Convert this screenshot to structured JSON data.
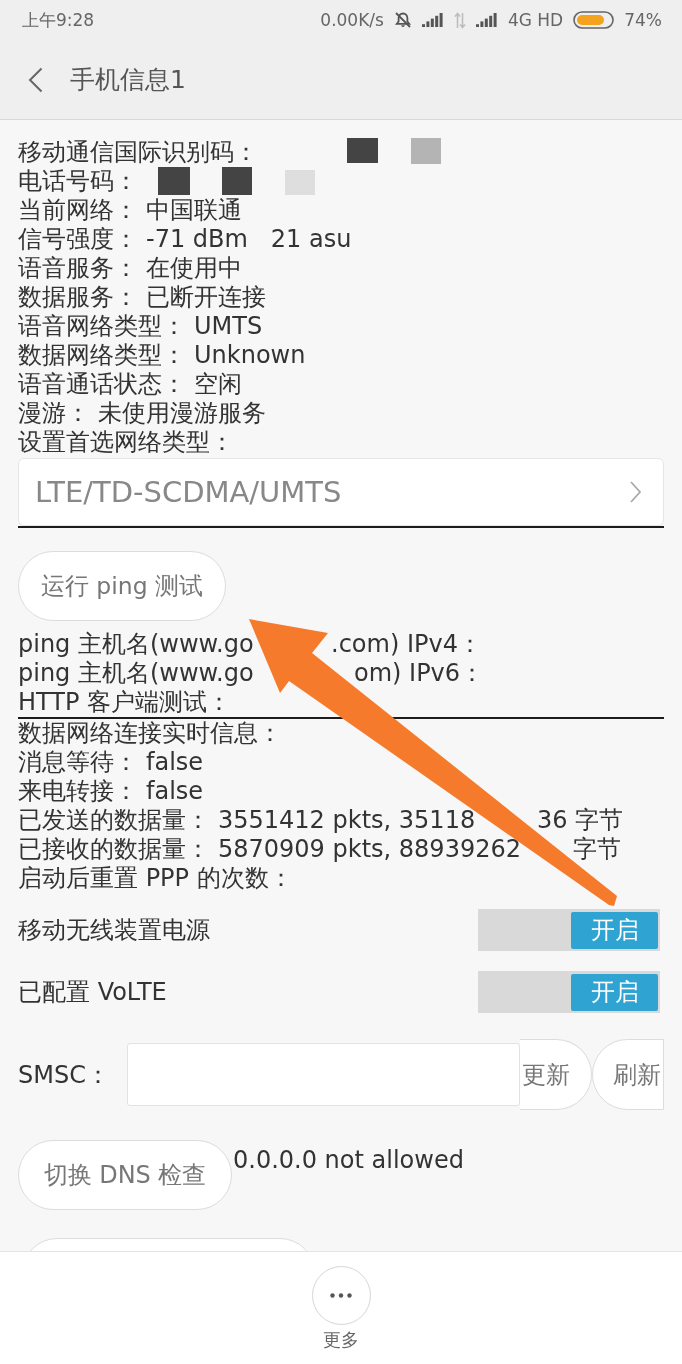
{
  "status_bar": {
    "time": "上午9:28",
    "speed": "0.00K/s",
    "network": "4G HD",
    "battery": "74%"
  },
  "header": {
    "title": "手机信息1"
  },
  "phone_info": [
    {
      "label": "移动通信国际识别码：",
      "redacted": true
    },
    {
      "label": "电话号码：",
      "redacted": true
    },
    {
      "label": "当前网络：",
      "value": "中国联通"
    },
    {
      "label": "信号强度：",
      "value": "-71 dBm   21 asu"
    },
    {
      "label": "语音服务：",
      "value": "在使用中"
    },
    {
      "label": "数据服务：",
      "value": "已断开连接"
    },
    {
      "label": "语音网络类型：",
      "value": "UMTS"
    },
    {
      "label": "数据网络类型：",
      "value": "Unknown"
    },
    {
      "label": "语音通话状态：",
      "value": "空闲"
    },
    {
      "label": "漫游：",
      "value": "未使用漫游服务"
    },
    {
      "label": "设置首选网络类型："
    }
  ],
  "preferred_network": {
    "value": "LTE/TD-SCDMA/UMTS"
  },
  "ping_button": {
    "label": "运行 ping 测试"
  },
  "ping_results": [
    {
      "label": "ping 主机名(www.go",
      "after_arrow": ".com) IPv4："
    },
    {
      "label": "ping 主机名(www.go",
      "after_arrow": "om) IPv6："
    },
    {
      "label": "HTTP 客户端测试："
    }
  ],
  "connection_info": [
    {
      "label": "数据网络连接实时信息："
    },
    {
      "label": "消息等待：",
      "value": "false"
    },
    {
      "label": "来电转接：",
      "value": "false"
    },
    {
      "label": "已发送的数据量：",
      "value": "3551412 pkts, 35118",
      "after_arrow": "36 字节"
    },
    {
      "label": "已接收的数据量：",
      "value": "5870909 pkts, 88939262",
      "after_arrow": "字节"
    },
    {
      "label": "启动后重置 PPP 的次数："
    }
  ],
  "switches": [
    {
      "label": "移动无线装置电源",
      "on": true,
      "state_text": "开启"
    },
    {
      "label": "已配置 VoLTE",
      "on": true,
      "state_text": "开启"
    }
  ],
  "smsc": {
    "label": "SMSC：",
    "buttons": [
      "更新",
      "刷新"
    ]
  },
  "dns": {
    "button": "切换 DNS 检查",
    "result": "0.0.0.0 not allowed"
  },
  "bottom_bar": {
    "more_label": "更多"
  }
}
